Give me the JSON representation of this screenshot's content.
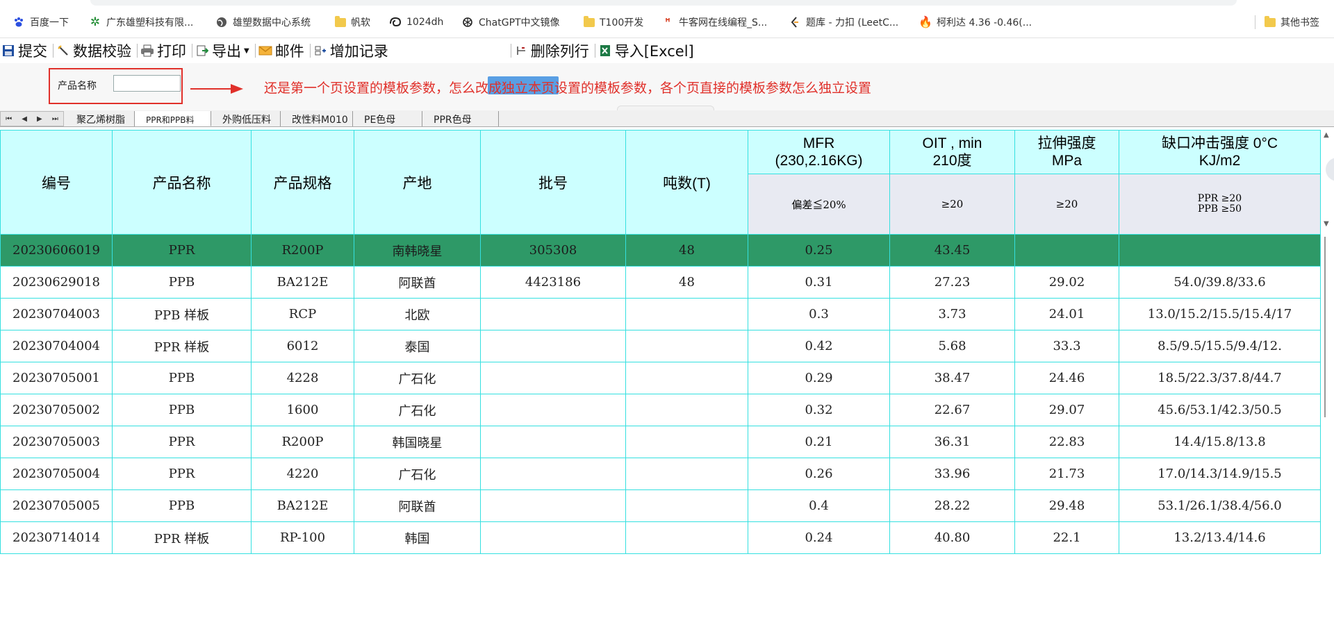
{
  "bookmarks": [
    {
      "label": "百度一下",
      "icon": "baidu-paw-icon"
    },
    {
      "label": "广东雄塑科技有限...",
      "icon": "plant-logo-icon"
    },
    {
      "label": "雄塑数据中心系统",
      "icon": "globe-icon"
    },
    {
      "label": "帆软",
      "icon": "folder-icon"
    },
    {
      "label": "1024dh",
      "icon": "spiral-logo-icon"
    },
    {
      "label": "ChatGPT中文镜像",
      "icon": "openai-logo-icon"
    },
    {
      "label": "T100开发",
      "icon": "folder-icon"
    },
    {
      "label": "牛客网在线编程_S...",
      "icon": "nowcoder-logo-icon"
    },
    {
      "label": "题库 - 力扣 (LeetC...",
      "icon": "leetcode-logo-icon"
    },
    {
      "label": "柯利达 4.36 -0.46(...",
      "icon": "flame-logo-icon"
    }
  ],
  "other_bookmarks": "其他书签",
  "toolbar": {
    "submit": "提交",
    "validate": "数据校验",
    "print": "打印",
    "export": "导出",
    "mail": "邮件",
    "add_record": "增加记录",
    "delete_row": "删除列行",
    "import_excel": "导入[Excel]"
  },
  "query": {
    "product_name_label": "产品名称",
    "product_name_value": "",
    "note": "还是第一个页设置的模板参数，怎么改成独立本页设置的模板参数，各个页直接的模板参数怎么独立设置"
  },
  "sheet_nav": [
    "⏮",
    "◀",
    "▶",
    "⏭"
  ],
  "sheet_tabs": [
    {
      "label": "聚乙烯树脂",
      "active": false
    },
    {
      "label": "PPR和PPB料",
      "active": true
    },
    {
      "label": "外购低压料",
      "active": false
    },
    {
      "label": "改性料M010",
      "active": false
    },
    {
      "label": "PE色母",
      "active": false
    },
    {
      "label": "PPR色母",
      "active": false
    }
  ],
  "table": {
    "headers": [
      "编号",
      "产品名称",
      "产品规格",
      "产地",
      "批号",
      "吨数(T)"
    ],
    "mfr_header": "MFR\n(230,2.16KG)",
    "mfr_spec": "偏差≦20%",
    "oit_header": "OIT , min\n210度",
    "oit_spec": "≥20",
    "tensile_header": "拉伸强度\nMPa",
    "tensile_spec": "≥20",
    "impact_header": "缺口冲击强度 0°C\nKJ/m2",
    "impact_spec": "PPR ≥20\nPPB ≥50",
    "rows": [
      [
        "20230606019",
        "PPR",
        "R200P",
        "南韩晓星",
        "305308",
        "48",
        "0.25",
        "43.45",
        "",
        ""
      ],
      [
        "20230629018",
        "PPB",
        "BA212E",
        "阿联酋",
        "4423186",
        "48",
        "0.31",
        "27.23",
        "29.02",
        "54.0/39.8/33.6"
      ],
      [
        "20230704003",
        "PPB 样板",
        "RCP",
        "北欧",
        "",
        "",
        "0.3",
        "3.73",
        "24.01",
        "13.0/15.2/15.5/15.4/17"
      ],
      [
        "20230704004",
        "PPR 样板",
        "6012",
        "泰国",
        "",
        "",
        "0.42",
        "5.68",
        "33.3",
        "8.5/9.5/15.5/9.4/12."
      ],
      [
        "20230705001",
        "PPB",
        "4228",
        "广石化",
        "",
        "",
        "0.29",
        "38.47",
        "24.46",
        "18.5/22.3/37.8/44.7"
      ],
      [
        "20230705002",
        "PPB",
        "1600",
        "广石化",
        "",
        "",
        "0.32",
        "22.67",
        "29.07",
        "45.6/53.1/42.3/50.5"
      ],
      [
        "20230705003",
        "PPR",
        "R200P",
        "韩国晓星",
        "",
        "",
        "0.21",
        "36.31",
        "22.83",
        "14.4/15.8/13.8"
      ],
      [
        "20230705004",
        "PPR",
        "4220",
        "广石化",
        "",
        "",
        "0.26",
        "33.96",
        "21.73",
        "17.0/14.3/14.9/15.5"
      ],
      [
        "20230705005",
        "PPB",
        "BA212E",
        "阿联酋",
        "",
        "",
        "0.4",
        "28.22",
        "29.48",
        "53.1/26.1/38.4/56.0"
      ],
      [
        "20230714014",
        "PPR 样板",
        "RP-100",
        "韩国",
        "",
        "",
        "0.24",
        "40.80",
        "22.1",
        "13.2/13.4/14.6"
      ]
    ],
    "selected_row": 0
  },
  "colors": {
    "header_bg": "#ccffff",
    "grid_line": "#34e0e0",
    "selected_row": "#2e9967",
    "annotation_red": "#e0302a"
  }
}
